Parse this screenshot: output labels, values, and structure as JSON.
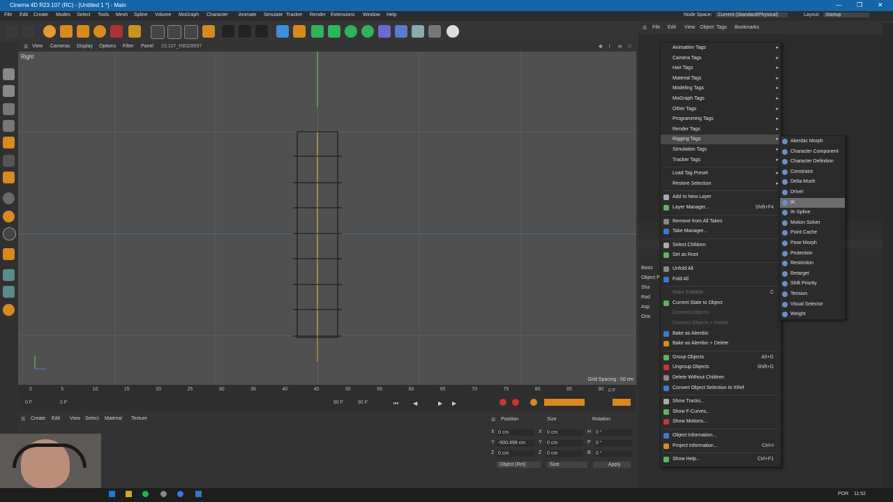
{
  "title": "Cinema 4D R23.107 (RC) - [Untitled 1 *] - Main",
  "menubar": [
    "File",
    "Edit",
    "Create",
    "Modes",
    "Select",
    "Tools",
    "Mesh",
    "Spline",
    "Volume",
    "MoGraph",
    "Character",
    "Animate",
    "Simulate",
    "Tracker",
    "Render",
    "Extensions",
    "Window",
    "Help"
  ],
  "nodespace_label": "Node Space:",
  "nodespace_value": "Current (Standard/Physical)",
  "layout_label": "Layout:",
  "layout_value": "Startup",
  "viewport": {
    "menu": [
      "View",
      "Cameras",
      "Display",
      "Options",
      "Filter",
      "Panel"
    ],
    "build": "23.107_RB328597",
    "view_name": "Right",
    "grid_spacing": "Grid Spacing : 50 cm"
  },
  "timeline": {
    "ticks": [
      "0",
      "5",
      "10",
      "15",
      "20",
      "25",
      "30",
      "35",
      "40",
      "45",
      "50",
      "55",
      "60",
      "65",
      "70",
      "75",
      "80",
      "85",
      "90"
    ],
    "start": "0 F",
    "start2": "0 F",
    "end": "90 F",
    "end2": "90 F",
    "current": "0 F"
  },
  "material_menu": [
    "Create",
    "Edit",
    "View",
    "Select",
    "Material",
    "Texture"
  ],
  "coords": {
    "headers": [
      "Position",
      "Size",
      "Rotation"
    ],
    "rows": [
      {
        "a": "X",
        "pos": "0 cm",
        "b": "X",
        "size": "0 cm",
        "c": "H",
        "rot": "0 °"
      },
      {
        "a": "Y",
        "pos": "-500.499 cm",
        "b": "Y",
        "size": "0 cm",
        "c": "P",
        "rot": "0 °"
      },
      {
        "a": "Z",
        "pos": "0 cm",
        "b": "Z",
        "size": "0 cm",
        "c": "B",
        "rot": "0 °"
      }
    ],
    "mode": "Object (Rel)",
    "sizemode": "Size",
    "apply": "Apply"
  },
  "objmanager_menu": [
    "File",
    "Edit",
    "View",
    "Object",
    "Tags",
    "Bookmarks"
  ],
  "attr_labels": [
    "Basic",
    "Object P",
    "Sha",
    "Rad",
    "Asp",
    "Orie"
  ],
  "context_menu": [
    {
      "label": "Animation Tags",
      "sub": true
    },
    {
      "label": "Camera Tags",
      "sub": true
    },
    {
      "label": "Hair Tags",
      "sub": true
    },
    {
      "label": "Material Tags",
      "sub": true
    },
    {
      "label": "Modeling Tags",
      "sub": true
    },
    {
      "label": "MoGraph Tags",
      "sub": true
    },
    {
      "label": "Other Tags",
      "sub": true
    },
    {
      "label": "Programming Tags",
      "sub": true
    },
    {
      "label": "Render Tags",
      "sub": true
    },
    {
      "label": "Rigging Tags",
      "sub": true,
      "hl": true
    },
    {
      "label": "Simulation Tags",
      "sub": true
    },
    {
      "label": "Tracker Tags",
      "sub": true
    },
    {
      "sep": true
    },
    {
      "label": "Load Tag Preset",
      "sub": true
    },
    {
      "label": "Restore Selection",
      "sub": true
    },
    {
      "sep": true
    },
    {
      "label": "Add to New Layer",
      "icon": true
    },
    {
      "label": "Layer Manager...",
      "shortcut": "Shift+F4",
      "icon": true
    },
    {
      "sep": true
    },
    {
      "label": "Remove from All Takes",
      "icon": true
    },
    {
      "label": "Take Manager...",
      "icon": true
    },
    {
      "sep": true
    },
    {
      "label": "Select Children",
      "icon": true
    },
    {
      "label": "Set as Root",
      "icon": true
    },
    {
      "sep": true
    },
    {
      "label": "Unfold All",
      "icon": true
    },
    {
      "label": "Fold All",
      "icon": true
    },
    {
      "sep": true
    },
    {
      "label": "Make Editable",
      "shortcut": "C",
      "dis": true
    },
    {
      "label": "Current State to Object",
      "icon": true
    },
    {
      "label": "Connect Objects",
      "dis": true
    },
    {
      "label": "Connect Objects + Delete",
      "dis": true
    },
    {
      "label": "Bake as Alembic",
      "icon": true
    },
    {
      "label": "Bake as Alembic + Delete",
      "icon": true
    },
    {
      "sep": true
    },
    {
      "label": "Group Objects",
      "shortcut": "Alt+G",
      "icon": true
    },
    {
      "label": "Ungroup Objects",
      "shortcut": "Shift+G",
      "icon": true
    },
    {
      "label": "Delete Without Children",
      "icon": true
    },
    {
      "label": "Convert Object Selection to XRef",
      "icon": true
    },
    {
      "sep": true
    },
    {
      "label": "Show Tracks...",
      "icon": true
    },
    {
      "label": "Show F-Curves...",
      "icon": true
    },
    {
      "label": "Show Motions...",
      "icon": true
    },
    {
      "sep": true
    },
    {
      "label": "Object Information...",
      "icon": true
    },
    {
      "label": "Project Information...",
      "shortcut": "Ctrl+I",
      "icon": true
    },
    {
      "sep": true
    },
    {
      "label": "Show Help...",
      "shortcut": "Ctrl+F1",
      "icon": true
    }
  ],
  "rigging_submenu": [
    {
      "label": "Alembic Morph"
    },
    {
      "label": "Character Component"
    },
    {
      "label": "Character Definition"
    },
    {
      "label": "Constraint"
    },
    {
      "label": "Delta Mush"
    },
    {
      "label": "Driver"
    },
    {
      "label": "IK",
      "hl": true
    },
    {
      "label": "IK-Spline"
    },
    {
      "label": "Motion Solver"
    },
    {
      "label": "Point Cache"
    },
    {
      "label": "Pose Morph"
    },
    {
      "label": "Protection"
    },
    {
      "label": "Restriction"
    },
    {
      "label": "Retarget"
    },
    {
      "label": "Shift Priority"
    },
    {
      "label": "Tension"
    },
    {
      "label": "Visual Selector"
    },
    {
      "label": "Weight"
    }
  ],
  "taskbar": {
    "lang": "POR",
    "time": "11:52"
  },
  "colors": {
    "titlebar": "#1565a8",
    "menu_bg": "#2b2b2b",
    "viewport": "#505050",
    "accent": "#e39a2c"
  }
}
